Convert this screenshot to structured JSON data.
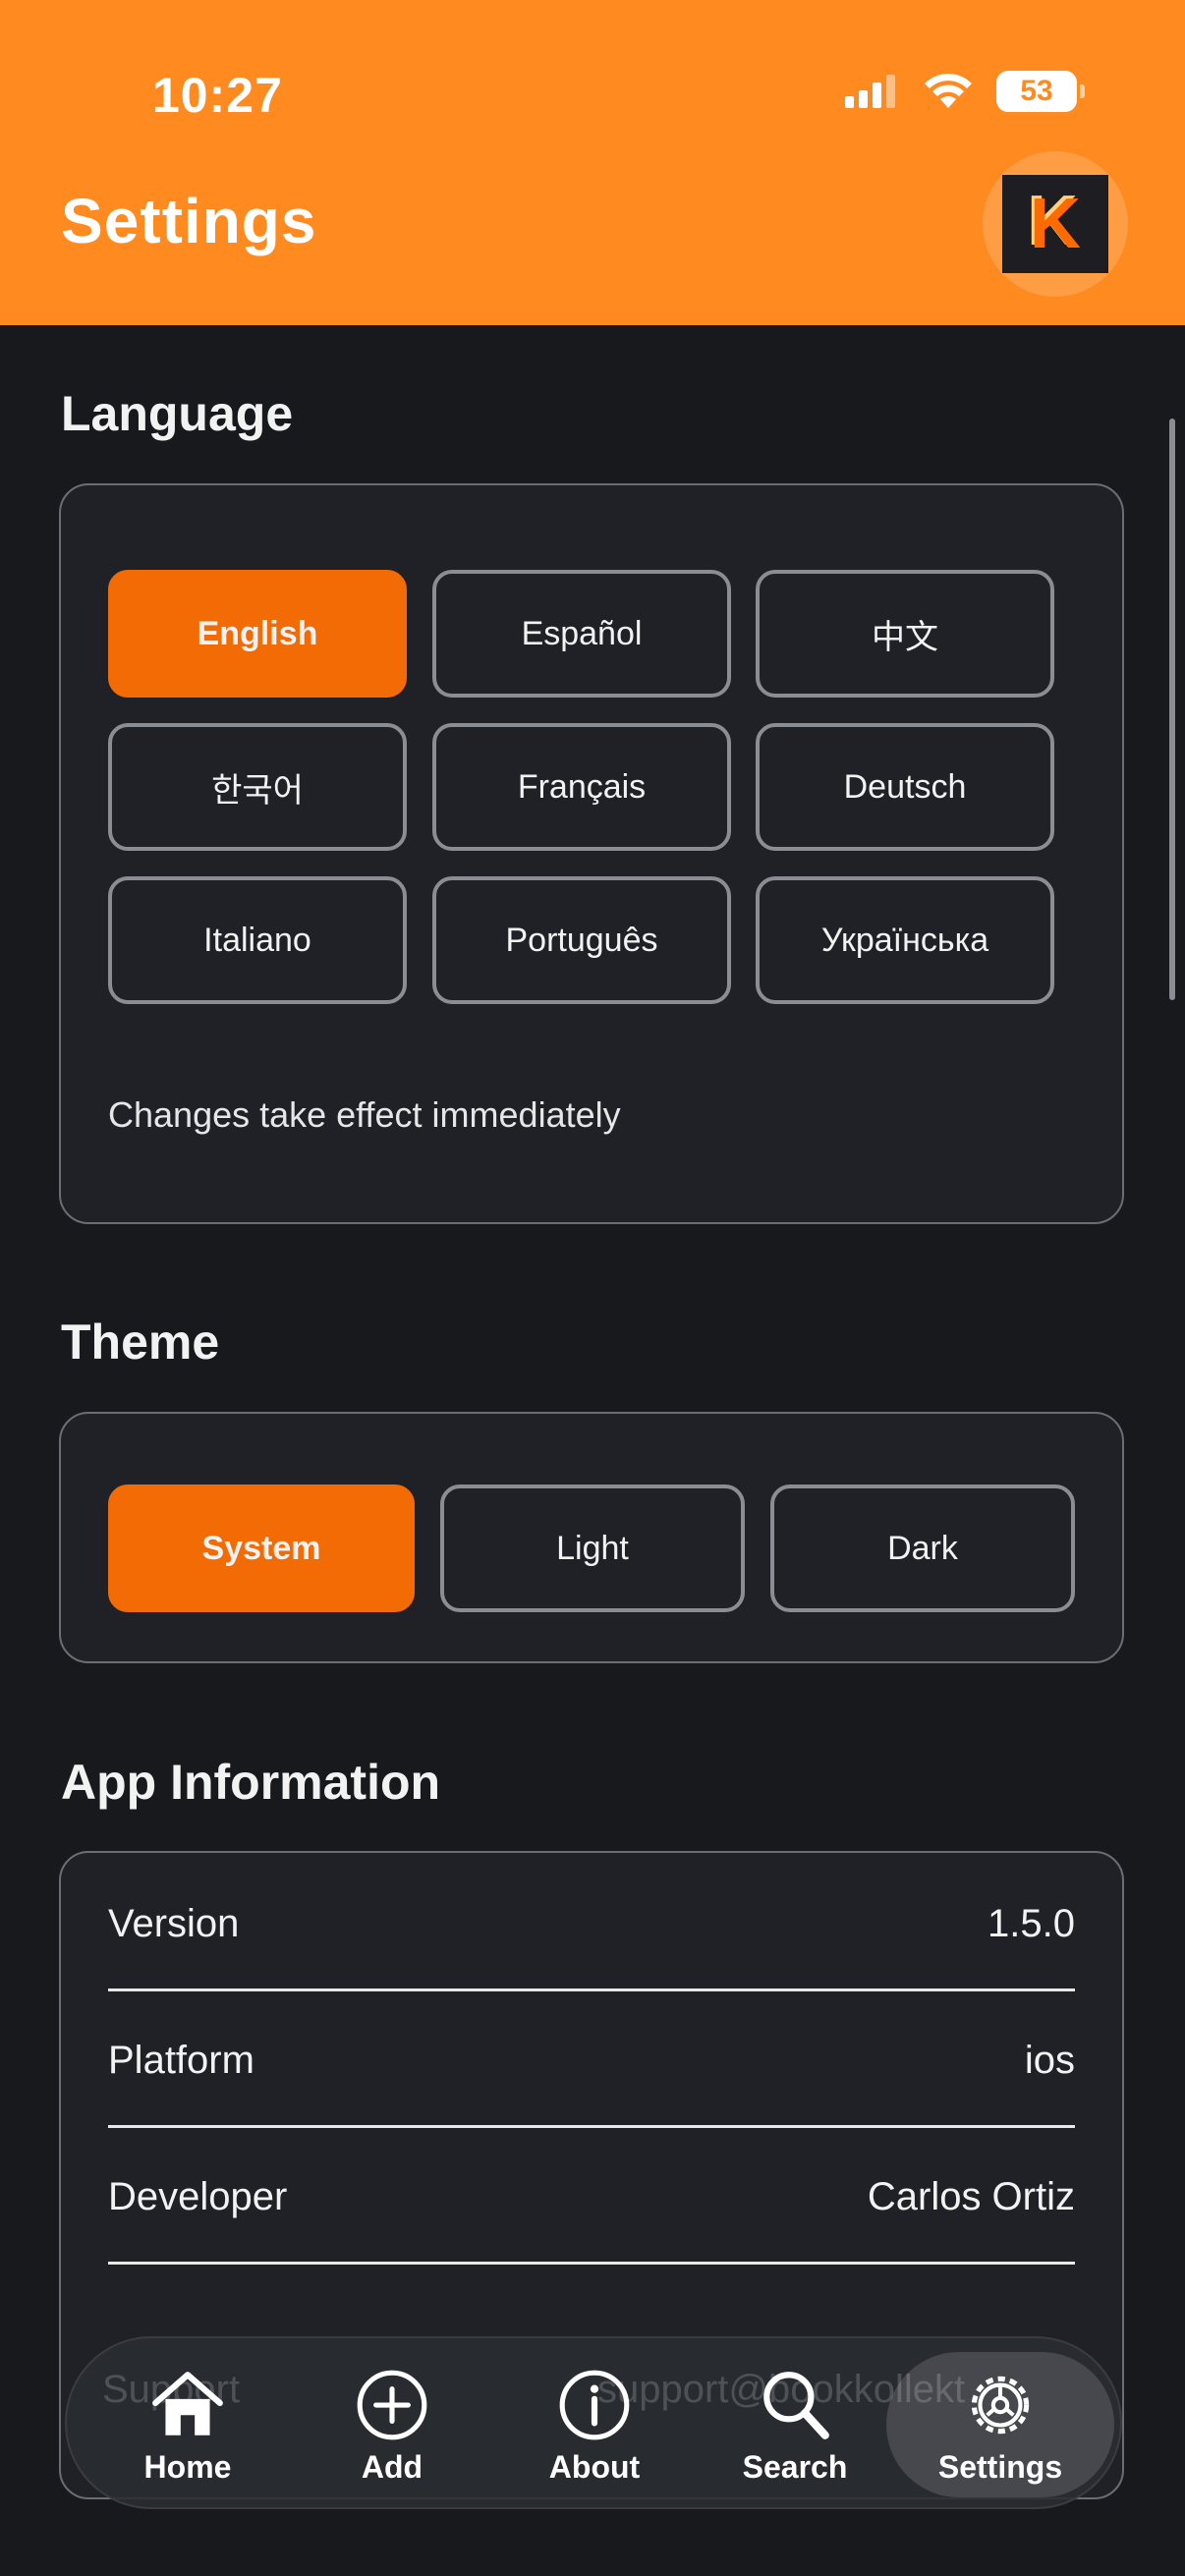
{
  "status_bar": {
    "time": "10:27",
    "battery": "53"
  },
  "header": {
    "title": "Settings",
    "avatar_letter": "K"
  },
  "language": {
    "title": "Language",
    "options": [
      "English",
      "Español",
      "中文",
      "한국어",
      "Français",
      "Deutsch",
      "Italiano",
      "Português",
      "Українська"
    ],
    "selected": "English",
    "note": "Changes take effect immediately"
  },
  "theme": {
    "title": "Theme",
    "options": [
      "System",
      "Light",
      "Dark"
    ],
    "selected": "System"
  },
  "app_info": {
    "title": "App Information",
    "rows": [
      {
        "label": "Version",
        "value": "1.5.0"
      },
      {
        "label": "Platform",
        "value": "ios"
      },
      {
        "label": "Developer",
        "value": "Carlos Ortiz"
      }
    ],
    "partial_row": {
      "label": "Support",
      "value": "support@bookkollekt"
    }
  },
  "tabs": [
    {
      "label": "Home",
      "icon": "home-icon"
    },
    {
      "label": "Add",
      "icon": "plus-circle-icon"
    },
    {
      "label": "About",
      "icon": "info-icon"
    },
    {
      "label": "Search",
      "icon": "search-icon"
    },
    {
      "label": "Settings",
      "icon": "gear-icon"
    }
  ],
  "active_tab": "Settings",
  "colors": {
    "header": "#ff8a1f",
    "accent": "#f26b05",
    "background": "#18191c",
    "card": "#1f2127"
  }
}
